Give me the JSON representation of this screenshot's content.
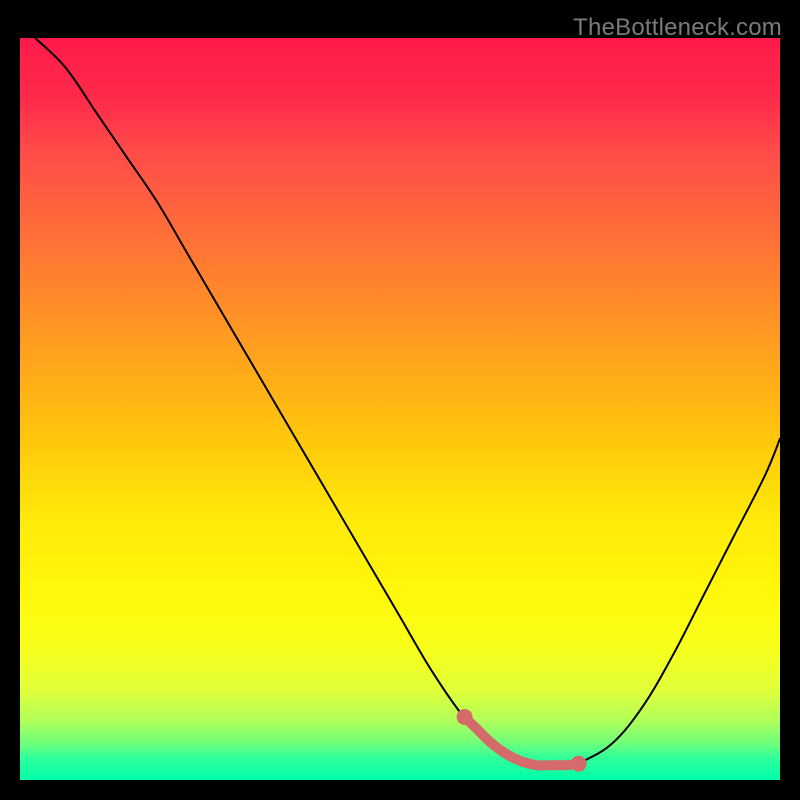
{
  "watermark": "TheBottleneck.com",
  "chart_data": {
    "type": "line",
    "title": "",
    "xlabel": "",
    "ylabel": "",
    "xlim": [
      0,
      100
    ],
    "ylim": [
      0,
      100
    ],
    "grid": false,
    "series": [
      {
        "name": "bottleneck-curve",
        "color": "#000000",
        "stroke_width": 2,
        "x": [
          2,
          6,
          10,
          14,
          18,
          22,
          26,
          30,
          34,
          38,
          42,
          46,
          50,
          54,
          58,
          60,
          62,
          64,
          66,
          68,
          70,
          72,
          74,
          78,
          82,
          86,
          90,
          94,
          98,
          100
        ],
        "y": [
          100,
          96,
          90,
          84,
          78,
          71,
          64,
          57,
          50,
          43,
          36,
          29,
          22,
          15,
          9,
          7,
          5,
          4,
          3,
          2.5,
          2,
          2,
          2.5,
          5,
          10,
          17,
          25,
          33,
          41,
          46
        ]
      },
      {
        "name": "highlight-segment",
        "color": "#d46a6a",
        "stroke_width": 10,
        "x": [
          58.5,
          60,
          62,
          64,
          66,
          68,
          70,
          72,
          73.5
        ],
        "y": [
          8.5,
          7,
          5,
          3.5,
          2.5,
          2,
          2,
          2,
          2.2
        ]
      }
    ],
    "markers": [
      {
        "name": "highlight-dot-left",
        "x": 58.5,
        "y": 8.5,
        "r": 8,
        "color": "#d46a6a"
      },
      {
        "name": "highlight-dot-right",
        "x": 73.5,
        "y": 2.2,
        "r": 8,
        "color": "#d46a6a"
      }
    ]
  }
}
